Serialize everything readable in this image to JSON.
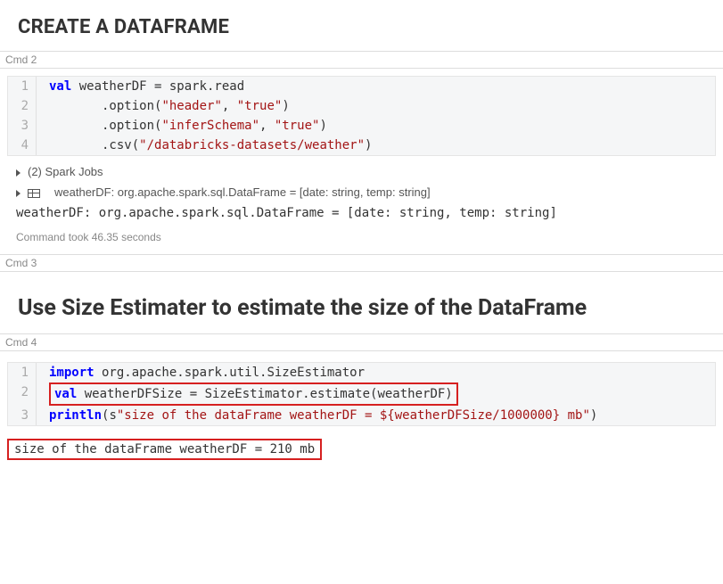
{
  "heading1": "CREATE A DATAFRAME",
  "cmd2": {
    "label": "Cmd 2"
  },
  "cell2": {
    "lines": [
      {
        "n": "1",
        "code": [
          {
            "t": "val ",
            "c": "kw"
          },
          {
            "t": "weatherDF = spark.read",
            "c": ""
          }
        ]
      },
      {
        "n": "2",
        "code": [
          {
            "t": "       .option(",
            "c": ""
          },
          {
            "t": "\"header\"",
            "c": "str"
          },
          {
            "t": ", ",
            "c": ""
          },
          {
            "t": "\"true\"",
            "c": "str"
          },
          {
            "t": ")",
            "c": ""
          }
        ]
      },
      {
        "n": "3",
        "code": [
          {
            "t": "       .option(",
            "c": ""
          },
          {
            "t": "\"inferSchema\"",
            "c": "str"
          },
          {
            "t": ", ",
            "c": ""
          },
          {
            "t": "\"true\"",
            "c": "str"
          },
          {
            "t": ")",
            "c": ""
          }
        ]
      },
      {
        "n": "4",
        "code": [
          {
            "t": "       .csv(",
            "c": ""
          },
          {
            "t": "\"/databricks-datasets/weather\"",
            "c": "str"
          },
          {
            "t": ")",
            "c": ""
          }
        ]
      }
    ]
  },
  "out2": {
    "jobs": "(2) Spark Jobs",
    "schema": "weatherDF:  org.apache.spark.sql.DataFrame = [date: string, temp: string]",
    "repl": "weatherDF: org.apache.spark.sql.DataFrame = [date: string, temp: string]",
    "time": "Command took 46.35 seconds"
  },
  "cmd3": {
    "label": "Cmd 3"
  },
  "heading2": "Use Size Estimater to estimate the size of the DataFrame",
  "cmd4": {
    "label": "Cmd 4"
  },
  "cell4": {
    "lines": [
      {
        "n": "1",
        "hl": false,
        "code": [
          {
            "t": "import",
            "c": "kw"
          },
          {
            "t": " org.apache.spark.util.SizeEstimator",
            "c": ""
          }
        ]
      },
      {
        "n": "2",
        "hl": true,
        "code": [
          {
            "t": "val ",
            "c": "kw"
          },
          {
            "t": "weatherDFSize = SizeEstimator.estimate(weatherDF)",
            "c": ""
          }
        ]
      },
      {
        "n": "3",
        "hl": false,
        "code": [
          {
            "t": "println",
            "c": "kw"
          },
          {
            "t": "(s",
            "c": ""
          },
          {
            "t": "\"size of the dataFrame weatherDF = ${weatherDFSize/1000000} mb\"",
            "c": "str"
          },
          {
            "t": ")",
            "c": ""
          }
        ]
      }
    ]
  },
  "out4": {
    "text": "size of the dataFrame weatherDF = 210 mb"
  }
}
